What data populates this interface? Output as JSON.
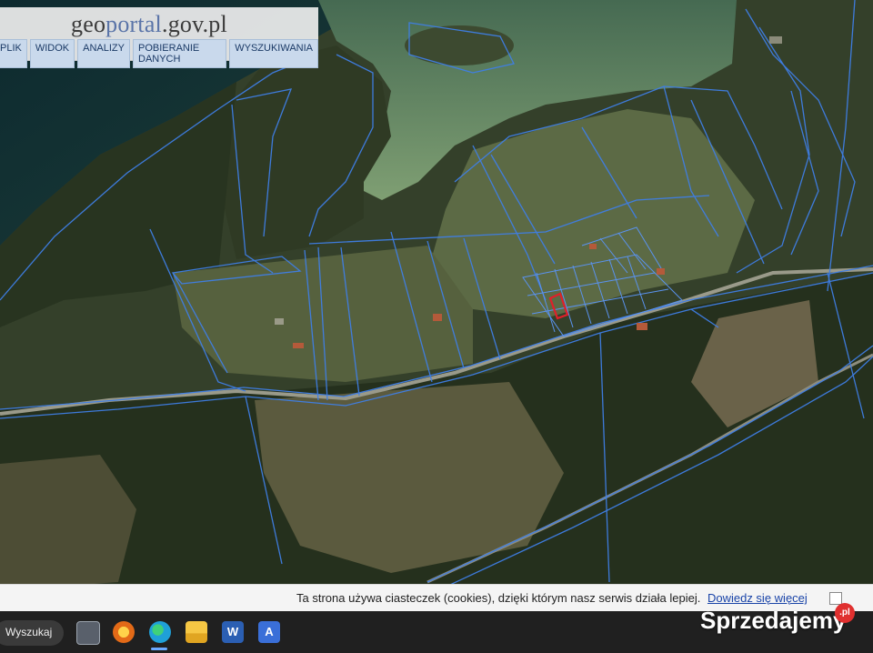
{
  "site": {
    "logo_text": "geoportal.gov.pl",
    "logo_part1": "geo",
    "logo_part2": "portal",
    "logo_part3": ".gov.pl"
  },
  "menu": {
    "items": [
      {
        "label": "PLIK"
      },
      {
        "label": "WIDOK"
      },
      {
        "label": "ANALIZY"
      },
      {
        "label": "POBIERANIE DANYCH"
      },
      {
        "label": "WYSZUKIWANIA"
      }
    ]
  },
  "map": {
    "layer": "orthophoto",
    "parcel_color": "#3f7fe6",
    "highlight_color": "#e0202a"
  },
  "cookie_bar": {
    "text": "Ta strona używa ciasteczek (cookies), dzięki którym nasz serwis działa lepiej.",
    "link_text": "Dowiedz się więcej"
  },
  "taskbar": {
    "search_label": "Wyszukaj",
    "apps": [
      {
        "icon": "task-view-icon",
        "color": "#9aa3ad"
      },
      {
        "icon": "brave-like-browser-icon",
        "color": "#f4b41a"
      },
      {
        "icon": "edge-icon",
        "color": "#1fa0d8"
      },
      {
        "icon": "file-explorer-icon",
        "color": "#f6c744"
      },
      {
        "icon": "word-icon",
        "color": "#2b5fb3"
      },
      {
        "icon": "app-icon",
        "color": "#3a6fd8"
      }
    ]
  },
  "watermark": {
    "brand": "Sprzedajemy",
    "badge": ".pl"
  }
}
